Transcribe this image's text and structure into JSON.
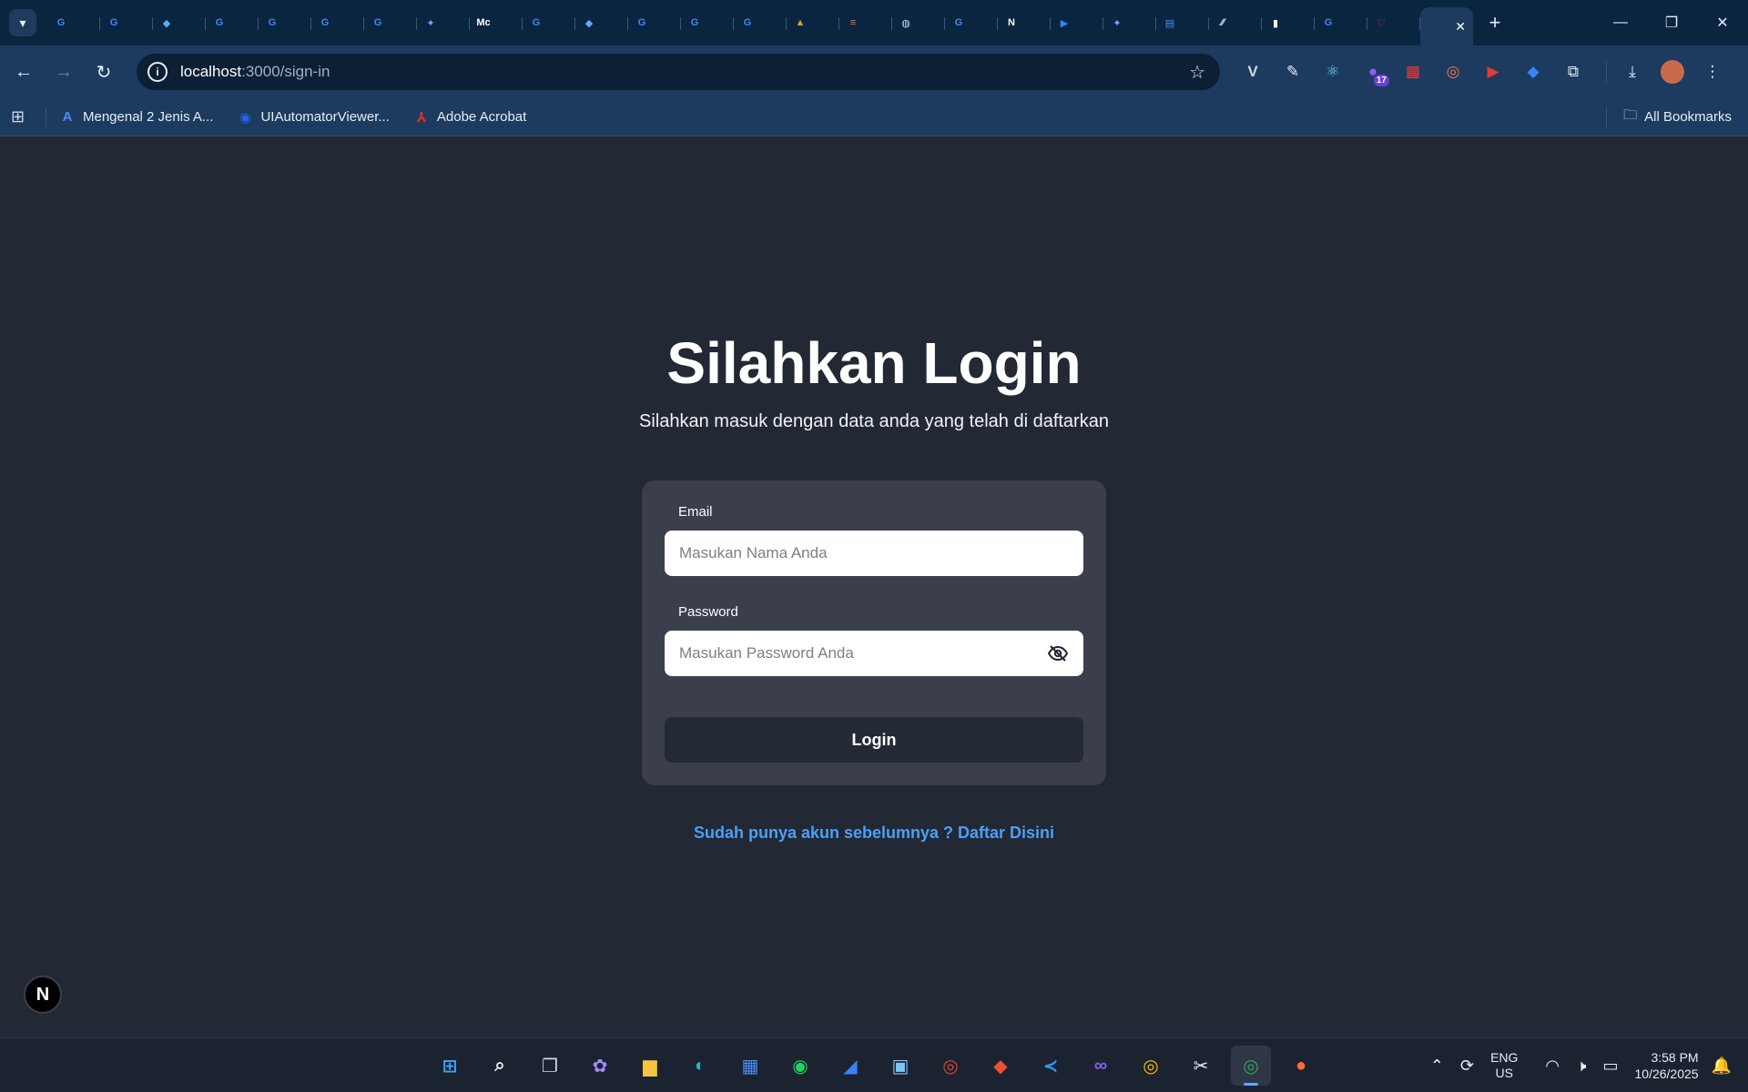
{
  "browser": {
    "tabs": [
      {
        "icon": "G",
        "color": "#4285f4"
      },
      {
        "icon": "G",
        "color": "#4285f4"
      },
      {
        "icon": "◆",
        "color": "#5fa8ff"
      },
      {
        "icon": "G",
        "color": "#4285f4"
      },
      {
        "icon": "G",
        "color": "#4285f4"
      },
      {
        "icon": "G",
        "color": "#4285f4"
      },
      {
        "icon": "G",
        "color": "#4285f4"
      },
      {
        "icon": "✦",
        "color": "#7aa7ff"
      },
      {
        "icon": "Mc",
        "color": "#ffffff"
      },
      {
        "icon": "G",
        "color": "#4285f4"
      },
      {
        "icon": "◆",
        "color": "#5fa8ff"
      },
      {
        "icon": "G",
        "color": "#4285f4"
      },
      {
        "icon": "G",
        "color": "#4285f4"
      },
      {
        "icon": "G",
        "color": "#4285f4"
      },
      {
        "icon": "▲",
        "color": "#e0a030"
      },
      {
        "icon": "≡",
        "color": "#f48024"
      },
      {
        "icon": "◍",
        "color": "#cfd8e3"
      },
      {
        "icon": "G",
        "color": "#4285f4"
      },
      {
        "icon": "N",
        "color": "#ffffff"
      },
      {
        "icon": "▶",
        "color": "#3b82f6"
      },
      {
        "icon": "✦",
        "color": "#7aa7ff"
      },
      {
        "icon": "▤",
        "color": "#4c8bf5"
      },
      {
        "icon": "⁄⁄",
        "color": "#ffffff"
      },
      {
        "icon": "▮",
        "color": "#ffffff"
      },
      {
        "icon": "G",
        "color": "#4285f4"
      },
      {
        "icon": "♡",
        "color": "#ff2d20"
      }
    ],
    "url_host": "localhost",
    "url_path": ":3000/sign-in",
    "extension_badge": "17",
    "bookmarks": [
      {
        "label": "Mengenal 2 Jenis A...",
        "icon": "A",
        "color": "#4c8bf5"
      },
      {
        "label": "UIAutomatorViewer...",
        "icon": "◉",
        "color": "#2563eb"
      },
      {
        "label": "Adobe Acrobat",
        "icon": "⅄",
        "color": "#d32f2f"
      }
    ],
    "all_bookmarks": "All Bookmarks"
  },
  "page": {
    "title": "Silahkan Login",
    "subtitle": "Silahkan masuk dengan data anda yang telah di daftarkan",
    "email_label": "Email",
    "email_placeholder": "Masukan Nama Anda",
    "password_label": "Password",
    "password_placeholder": "Masukan Password Anda",
    "login_button": "Login",
    "register_link": "Sudah punya akun sebelumnya ? Daftar Disini",
    "next_badge": "N"
  },
  "taskbar": {
    "lang_top": "ENG",
    "lang_bottom": "US",
    "time": "3:58 PM",
    "date": "10/26/2025"
  }
}
